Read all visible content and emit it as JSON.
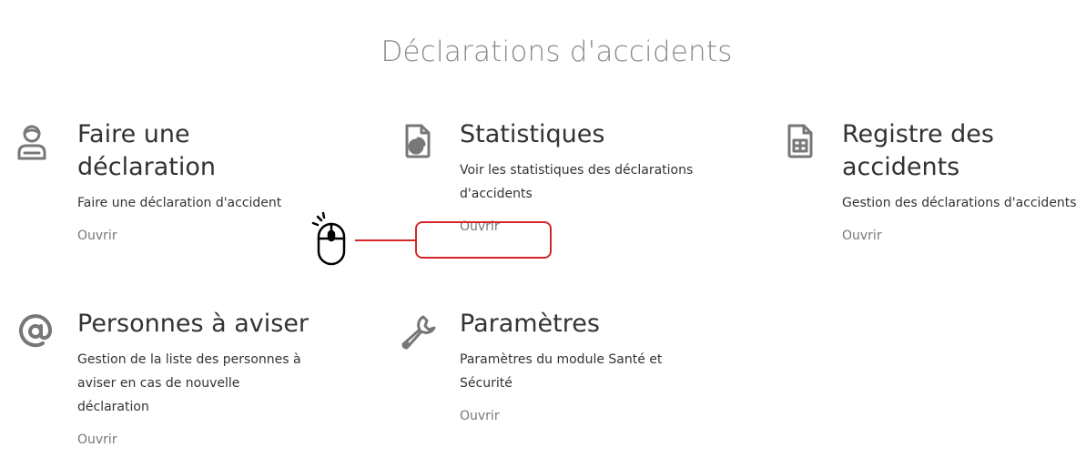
{
  "page": {
    "title": "Déclarations d'accidents"
  },
  "cards": {
    "declaration": {
      "icon": "worker-icon",
      "title": "Faire une déclaration",
      "description": "Faire une déclaration d'accident",
      "link": "Ouvrir"
    },
    "stats": {
      "icon": "file-chart-icon",
      "title": "Statistiques",
      "description": "Voir les statistiques des déclarations d'accidents",
      "link": "Ouvrir"
    },
    "registre": {
      "icon": "file-table-icon",
      "title": "Registre des accidents",
      "description": "Gestion des déclarations d'accidents",
      "link": "Ouvrir"
    },
    "personnes": {
      "icon": "at-sign-icon",
      "title": "Personnes à aviser",
      "description": "Gestion de la liste des personnes à aviser en cas de nouvelle déclaration",
      "link": "Ouvrir"
    },
    "parametres": {
      "icon": "wrench-icon",
      "title": "Paramètres",
      "description": "Paramètres du module Santé et Sécurité",
      "link": "Ouvrir"
    }
  },
  "annotation": {
    "icon": "mouse-click-icon",
    "highlight_color": "#d6262b"
  },
  "colors": {
    "title": "#8a8a8a",
    "text": "#333333",
    "link": "#777777",
    "icon": "#777777"
  }
}
